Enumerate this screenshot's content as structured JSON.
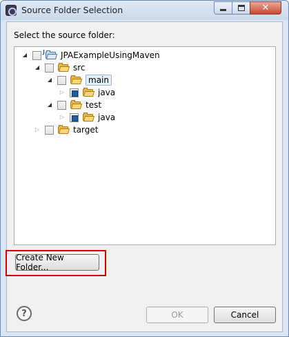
{
  "window": {
    "title": "Source Folder Selection"
  },
  "prompt": "Select the source folder:",
  "tree": {
    "items": [
      {
        "label": "JPAExampleUsingMaven",
        "expanded": true,
        "checked": false,
        "icon": "project-folder-icon"
      },
      {
        "label": "src",
        "expanded": true,
        "checked": false,
        "icon": "folder-icon"
      },
      {
        "label": "main",
        "expanded": true,
        "checked": false,
        "icon": "folder-icon",
        "selected": true
      },
      {
        "label": "java",
        "expanded": false,
        "checked": true,
        "icon": "folder-icon"
      },
      {
        "label": "test",
        "expanded": true,
        "checked": false,
        "icon": "folder-icon"
      },
      {
        "label": "java",
        "expanded": false,
        "checked": true,
        "icon": "folder-icon"
      },
      {
        "label": "target",
        "expanded": false,
        "checked": false,
        "icon": "folder-icon"
      }
    ]
  },
  "buttons": {
    "create_new_folder": "Create New Folder...",
    "ok": "OK",
    "cancel": "Cancel",
    "help": "?"
  },
  "colors": {
    "highlight_border": "#d40000",
    "selection_fill": "#e6f0fb"
  }
}
